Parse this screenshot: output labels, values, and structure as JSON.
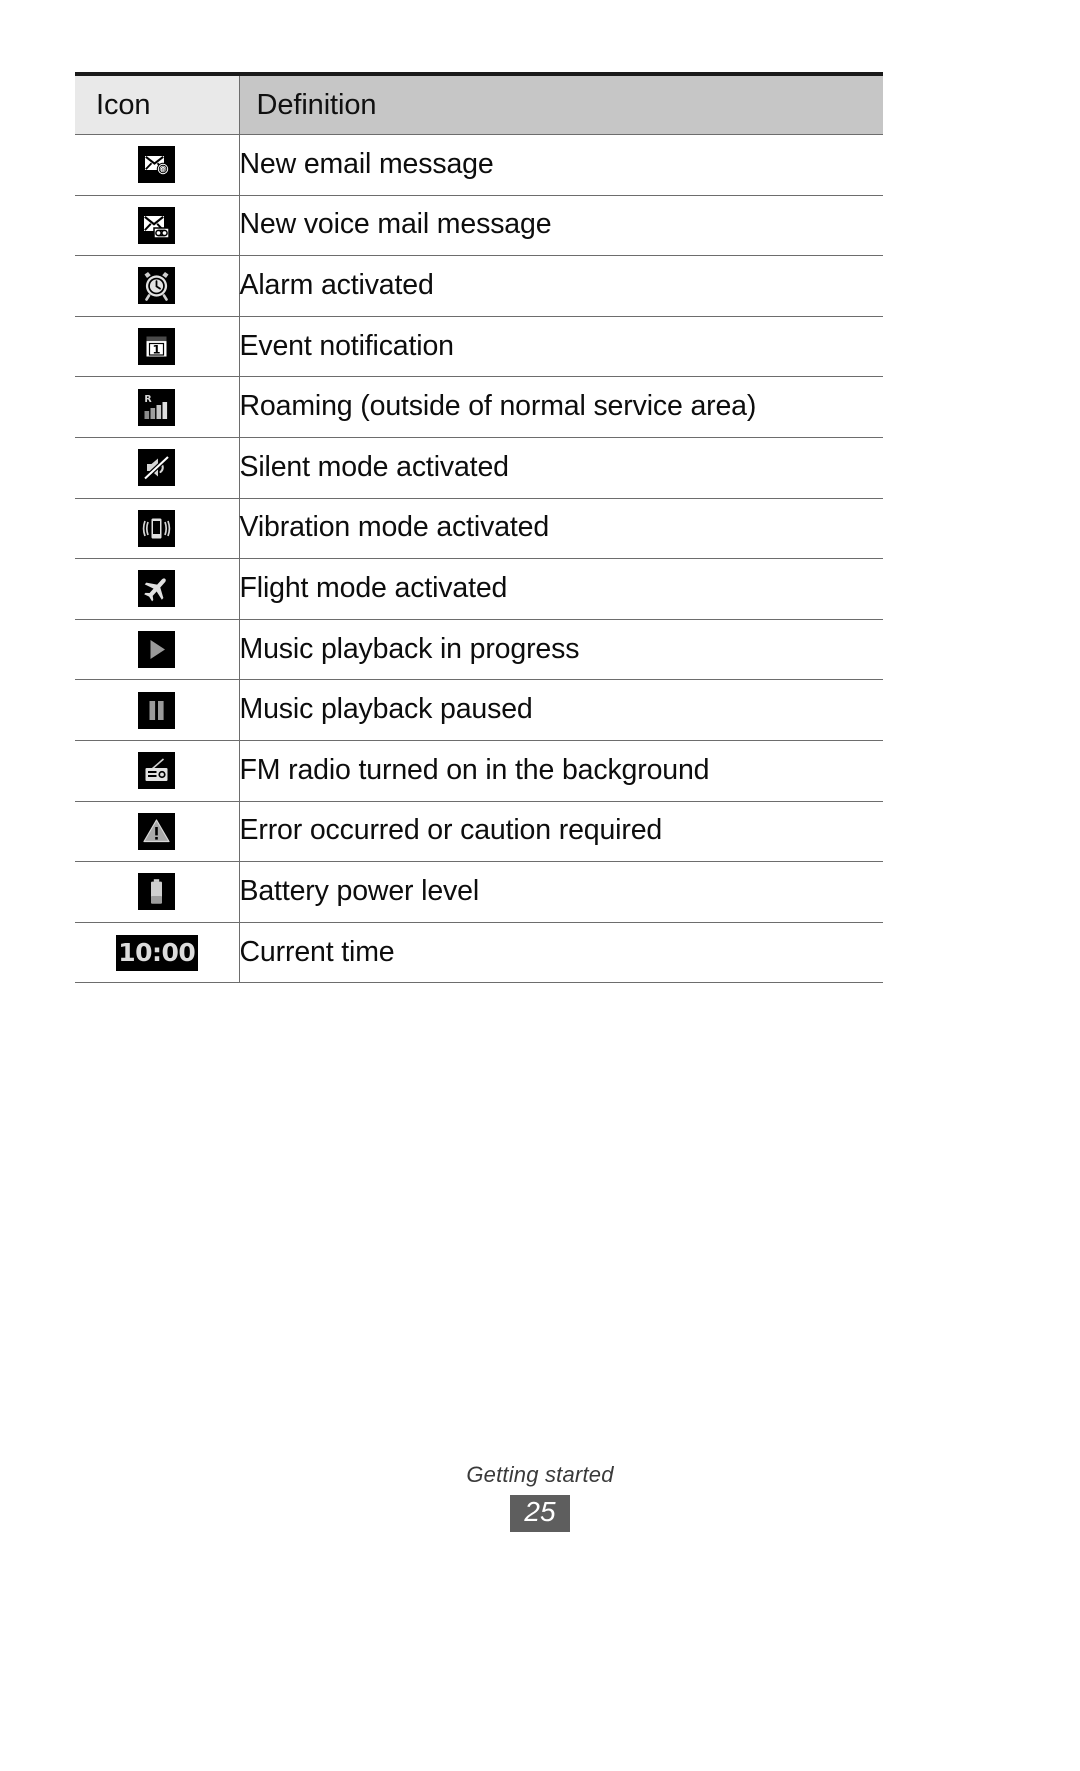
{
  "document": {
    "table": {
      "columns": [
        "Icon",
        "Definition"
      ],
      "rows": [
        {
          "icon": "new-email-message-icon",
          "definition": "New email message"
        },
        {
          "icon": "new-voice-mail-message-icon",
          "definition": "New voice mail message"
        },
        {
          "icon": "alarm-clock-icon",
          "definition": "Alarm activated"
        },
        {
          "icon": "calendar-event-icon",
          "definition": "Event notification"
        },
        {
          "icon": "roaming-signal-bars-icon",
          "definition": "Roaming (outside of normal service area)"
        },
        {
          "icon": "silent-mute-speaker-icon",
          "definition": "Silent mode activated"
        },
        {
          "icon": "vibration-phone-icon",
          "definition": "Vibration mode activated"
        },
        {
          "icon": "flight-airplane-icon",
          "definition": "Flight mode activated"
        },
        {
          "icon": "music-play-icon",
          "definition": "Music playback in progress"
        },
        {
          "icon": "music-pause-icon",
          "definition": "Music playback paused"
        },
        {
          "icon": "fm-radio-icon",
          "definition": "FM radio turned on in the background"
        },
        {
          "icon": "warning-triangle-icon",
          "definition": "Error occurred or caution required"
        },
        {
          "icon": "battery-level-icon",
          "definition": "Battery power level"
        },
        {
          "icon": "current-time-badge",
          "icon_text": "10:00",
          "definition": "Current time"
        }
      ]
    },
    "footer": {
      "section_title": "Getting started",
      "page_number": "25"
    },
    "colors": {
      "header_icon_bg": "#e9e9e9",
      "header_def_bg": "#c6c6c6",
      "rule": "#6d6d6d",
      "top_rule": "#1a1a1a",
      "badge_bg": "#000000",
      "badge_fg": "#b3b3b3",
      "page_box_bg": "#5e5e5e",
      "text": "#0d0d0d"
    }
  }
}
